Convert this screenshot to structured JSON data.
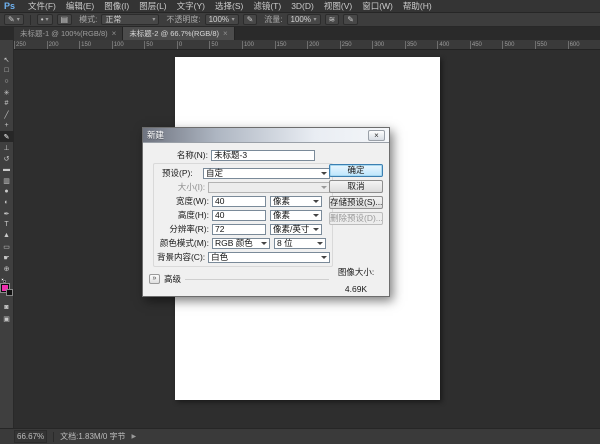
{
  "menu_bar": {
    "logo": "Ps",
    "items": [
      "文件(F)",
      "编辑(E)",
      "图像(I)",
      "图层(L)",
      "文字(Y)",
      "选择(S)",
      "滤镜(T)",
      "3D(D)",
      "视图(V)",
      "窗口(W)",
      "帮助(H)"
    ]
  },
  "icons": {
    "dropdown_arrow": "▾",
    "brush_tool": "✎",
    "brush_panel_toggle": "▤",
    "pen_pressure": "✎",
    "airbrush": "≋",
    "dialog_close": "×",
    "advanced_toggle": "»",
    "status_arrow": "▶",
    "quick_mask": "◙",
    "screen_mode": "▣"
  },
  "options_bar": {
    "mode_label": "模式:",
    "mode_value": "正常",
    "opacity_label": "不透明度:",
    "opacity_value": "100%",
    "flow_label": "流量:",
    "flow_value": "100%"
  },
  "tabs": [
    {
      "label": "未标题-1 @ 100%(RGB/8)",
      "close": "×"
    },
    {
      "label": "未标题-2 @ 66.7%(RGB/8)",
      "close": "×"
    }
  ],
  "ruler": {
    "ticks": [
      "250",
      "200",
      "150",
      "100",
      "50",
      "0",
      "50",
      "100",
      "150",
      "200",
      "250",
      "300",
      "350",
      "400",
      "450",
      "500",
      "550",
      "600"
    ]
  },
  "toolbar": {
    "tools": [
      {
        "name": "move-tool",
        "glyph": "↖"
      },
      {
        "name": "marquee-tool",
        "glyph": "□"
      },
      {
        "name": "lasso-tool",
        "glyph": "○"
      },
      {
        "name": "quick-selection-tool",
        "glyph": "✳"
      },
      {
        "name": "crop-tool",
        "glyph": "#"
      },
      {
        "name": "eyedropper-tool",
        "glyph": "╱"
      },
      {
        "name": "healing-brush-tool",
        "glyph": "+"
      },
      {
        "name": "brush-tool",
        "glyph": "✎"
      },
      {
        "name": "clone-stamp-tool",
        "glyph": "⊥"
      },
      {
        "name": "history-brush-tool",
        "glyph": "↺"
      },
      {
        "name": "eraser-tool",
        "glyph": "▬"
      },
      {
        "name": "gradient-tool",
        "glyph": "▥"
      },
      {
        "name": "blur-tool",
        "glyph": "●"
      },
      {
        "name": "dodge-tool",
        "glyph": "◐"
      },
      {
        "name": "pen-tool",
        "glyph": "✒"
      },
      {
        "name": "type-tool",
        "glyph": "T"
      },
      {
        "name": "path-selection-tool",
        "glyph": "▲"
      },
      {
        "name": "rectangle-tool",
        "glyph": "▭"
      },
      {
        "name": "hand-tool",
        "glyph": "☛"
      },
      {
        "name": "zoom-tool",
        "glyph": "⊕"
      }
    ],
    "foreground_color": "#ee2fae",
    "background_color": "#111111"
  },
  "dialog": {
    "title": "新建",
    "name_label": "名称(N):",
    "name_value": "未标题-3",
    "preset_label": "预设(P):",
    "preset_value": "自定",
    "size_label": "大小(I):",
    "size_value": "",
    "width_label": "宽度(W):",
    "width_value": "40",
    "width_unit": "像素",
    "height_label": "高度(H):",
    "height_value": "40",
    "height_unit": "像素",
    "resolution_label": "分辨率(R):",
    "resolution_value": "72",
    "resolution_unit": "像素/英寸",
    "color_mode_label": "颜色模式(M):",
    "color_mode_value": "RGB 颜色",
    "bit_depth_value": "8 位",
    "background_label": "背景内容(C):",
    "background_value": "白色",
    "advanced_label": "高级",
    "ok": "确定",
    "cancel": "取消",
    "save_preset": "存储预设(S)...",
    "delete_preset": "删除预设(D)...",
    "image_size_label": "图像大小:",
    "image_size_value": "4.69K"
  },
  "status_bar": {
    "zoom": "66.67%",
    "doc_info": "文档:1.83M/0 字节"
  }
}
